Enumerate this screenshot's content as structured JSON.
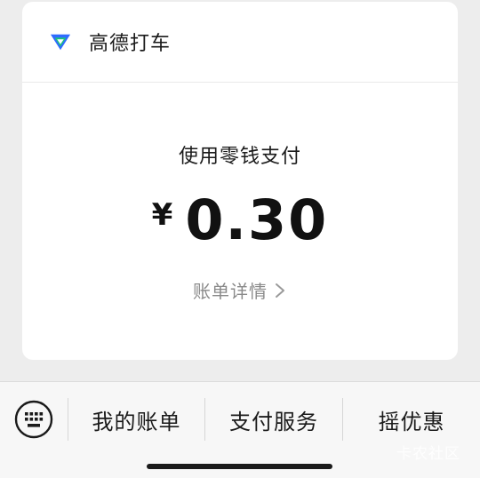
{
  "merchant": {
    "name": "高德打车",
    "logo_icon": "amap-logo-icon"
  },
  "payment": {
    "method_label": "使用零钱支付",
    "currency_symbol": "¥",
    "amount": "0.30",
    "detail_link": "账单详情"
  },
  "bottom_menu": {
    "keyboard_icon": "keyboard-icon",
    "items": [
      {
        "label": "我的账单"
      },
      {
        "label": "支付服务"
      },
      {
        "label": "摇优惠"
      }
    ]
  },
  "watermark": "卡农社区",
  "colors": {
    "background": "#ededed",
    "card": "#ffffff",
    "logo_green": "#19c37d",
    "logo_blue": "#2f6bff"
  }
}
